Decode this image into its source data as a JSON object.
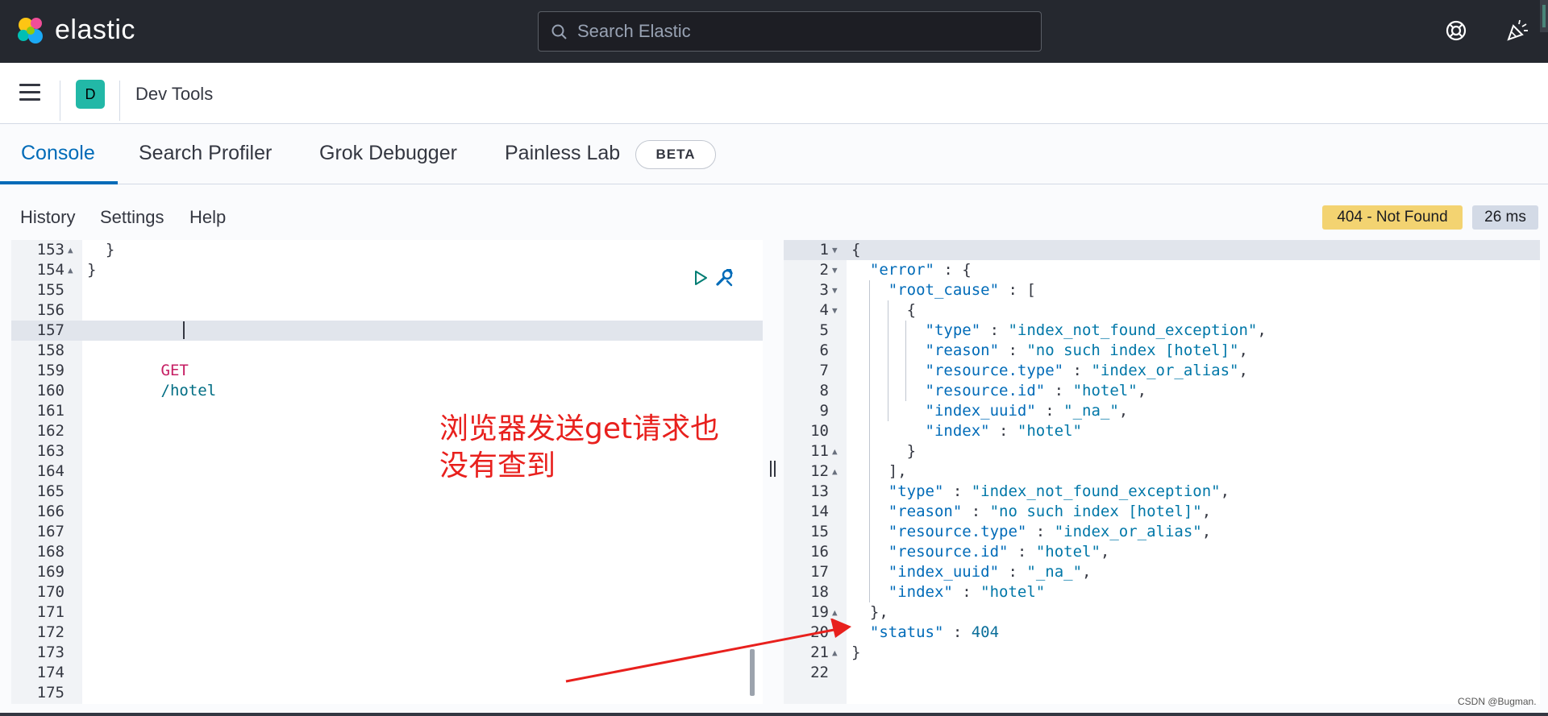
{
  "header": {
    "brand": "elastic",
    "search_placeholder": "Search Elastic"
  },
  "breadcrumb": {
    "avatar_letter": "D",
    "title": "Dev Tools"
  },
  "tabs": [
    {
      "label": "Console"
    },
    {
      "label": "Search Profiler"
    },
    {
      "label": "Grok Debugger"
    },
    {
      "label": "Painless Lab"
    }
  ],
  "beta_label": "BETA",
  "console_menu": {
    "history": "History",
    "settings": "Settings",
    "help": "Help"
  },
  "response_status": {
    "status": "404 - Not Found",
    "time": "26 ms"
  },
  "request_editor": {
    "lines": [
      {
        "n": "153",
        "fold": "▲",
        "code": "  }"
      },
      {
        "n": "154",
        "fold": "▲",
        "code": "}"
      },
      {
        "n": "155",
        "fold": "",
        "code": ""
      },
      {
        "n": "156",
        "fold": "",
        "code": ""
      },
      {
        "n": "157",
        "fold": "",
        "code": ""
      },
      {
        "n": "158",
        "fold": "",
        "code": ""
      },
      {
        "n": "159",
        "fold": "",
        "code": ""
      },
      {
        "n": "160",
        "fold": "",
        "code": ""
      },
      {
        "n": "161",
        "fold": "",
        "code": ""
      },
      {
        "n": "162",
        "fold": "",
        "code": ""
      },
      {
        "n": "163",
        "fold": "",
        "code": ""
      },
      {
        "n": "164",
        "fold": "",
        "code": ""
      },
      {
        "n": "165",
        "fold": "",
        "code": ""
      },
      {
        "n": "166",
        "fold": "",
        "code": ""
      },
      {
        "n": "167",
        "fold": "",
        "code": ""
      },
      {
        "n": "168",
        "fold": "",
        "code": ""
      },
      {
        "n": "169",
        "fold": "",
        "code": ""
      },
      {
        "n": "170",
        "fold": "",
        "code": ""
      },
      {
        "n": "171",
        "fold": "",
        "code": ""
      },
      {
        "n": "172",
        "fold": "",
        "code": ""
      },
      {
        "n": "173",
        "fold": "",
        "code": ""
      },
      {
        "n": "174",
        "fold": "",
        "code": ""
      },
      {
        "n": "175",
        "fold": "",
        "code": ""
      }
    ],
    "request_method": "GET",
    "request_path": "/hotel"
  },
  "response_editor": {
    "lines": [
      {
        "n": "1",
        "fold": "▼",
        "code": "{"
      },
      {
        "n": "2",
        "fold": "▼",
        "code": "  \"error\" : {"
      },
      {
        "n": "3",
        "fold": "▼",
        "code": "    \"root_cause\" : ["
      },
      {
        "n": "4",
        "fold": "▼",
        "code": "      {"
      },
      {
        "n": "5",
        "fold": "",
        "code": "        \"type\" : \"index_not_found_exception\","
      },
      {
        "n": "6",
        "fold": "",
        "code": "        \"reason\" : \"no such index [hotel]\","
      },
      {
        "n": "7",
        "fold": "",
        "code": "        \"resource.type\" : \"index_or_alias\","
      },
      {
        "n": "8",
        "fold": "",
        "code": "        \"resource.id\" : \"hotel\","
      },
      {
        "n": "9",
        "fold": "",
        "code": "        \"index_uuid\" : \"_na_\","
      },
      {
        "n": "10",
        "fold": "",
        "code": "        \"index\" : \"hotel\""
      },
      {
        "n": "11",
        "fold": "▲",
        "code": "      }"
      },
      {
        "n": "12",
        "fold": "▲",
        "code": "    ],"
      },
      {
        "n": "13",
        "fold": "",
        "code": "    \"type\" : \"index_not_found_exception\","
      },
      {
        "n": "14",
        "fold": "",
        "code": "    \"reason\" : \"no such index [hotel]\","
      },
      {
        "n": "15",
        "fold": "",
        "code": "    \"resource.type\" : \"index_or_alias\","
      },
      {
        "n": "16",
        "fold": "",
        "code": "    \"resource.id\" : \"hotel\","
      },
      {
        "n": "17",
        "fold": "",
        "code": "    \"index_uuid\" : \"_na_\","
      },
      {
        "n": "18",
        "fold": "",
        "code": "    \"index\" : \"hotel\""
      },
      {
        "n": "19",
        "fold": "▲",
        "code": "  },"
      },
      {
        "n": "20",
        "fold": "",
        "code": "  \"status\" : 404"
      },
      {
        "n": "21",
        "fold": "▲",
        "code": "}"
      },
      {
        "n": "22",
        "fold": "",
        "code": ""
      }
    ]
  },
  "annotation": {
    "line1": "浏览器发送get请求也",
    "line2": "没有查到"
  },
  "watermark": "CSDN @Bugman.",
  "colors": {
    "header_bg": "#25282f",
    "accent": "#006bb8",
    "warning_badge": "#f3d371",
    "annotation_red": "#e8201d",
    "avatar": "#22b8a7"
  }
}
